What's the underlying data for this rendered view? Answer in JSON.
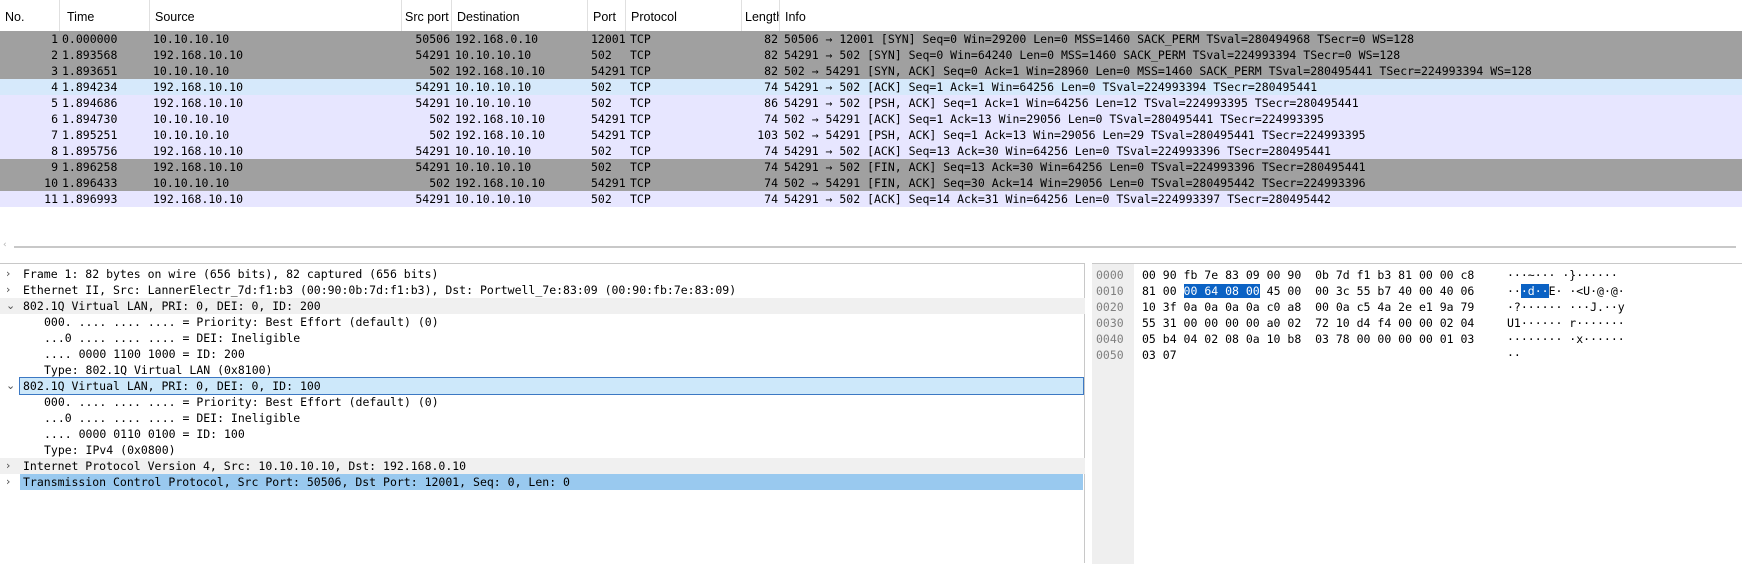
{
  "columns": [
    "No.",
    "Time",
    "Source",
    "Src port",
    "Destination",
    "Port",
    "Protocol",
    "Length",
    "Info"
  ],
  "packets": [
    {
      "no": "1",
      "time": "0.000000",
      "src": "10.10.10.10",
      "sport": "50506",
      "dst": "192.168.0.10",
      "port": "12001",
      "proto": "TCP",
      "len": "82",
      "info": "50506 → 12001 [SYN] Seq=0 Win=29200 Len=0 MSS=1460 SACK_PERM TSval=280494968 TSecr=0 WS=128",
      "style": "gray"
    },
    {
      "no": "2",
      "time": "1.893568",
      "src": "192.168.10.10",
      "sport": "54291",
      "dst": "10.10.10.10",
      "port": "502",
      "proto": "TCP",
      "len": "82",
      "info": "54291 → 502 [SYN] Seq=0 Win=64240 Len=0 MSS=1460 SACK_PERM TSval=224993394 TSecr=0 WS=128",
      "style": "gray"
    },
    {
      "no": "3",
      "time": "1.893651",
      "src": "10.10.10.10",
      "sport": "502",
      "dst": "192.168.10.10",
      "port": "54291",
      "proto": "TCP",
      "len": "82",
      "info": "502 → 54291 [SYN, ACK] Seq=0 Ack=1 Win=28960 Len=0 MSS=1460 SACK_PERM TSval=280495441 TSecr=224993394 WS=128",
      "style": "gray"
    },
    {
      "no": "4",
      "time": "1.894234",
      "src": "192.168.10.10",
      "sport": "54291",
      "dst": "10.10.10.10",
      "port": "502",
      "proto": "TCP",
      "len": "74",
      "info": "54291 → 502 [ACK] Seq=1 Ack=1 Win=64256 Len=0 TSval=224993394 TSecr=280495441",
      "style": "sel"
    },
    {
      "no": "5",
      "time": "1.894686",
      "src": "192.168.10.10",
      "sport": "54291",
      "dst": "10.10.10.10",
      "port": "502",
      "proto": "TCP",
      "len": "86",
      "info": "54291 → 502 [PSH, ACK] Seq=1 Ack=1 Win=64256 Len=12 TSval=224993395 TSecr=280495441",
      "style": "light"
    },
    {
      "no": "6",
      "time": "1.894730",
      "src": "10.10.10.10",
      "sport": "502",
      "dst": "192.168.10.10",
      "port": "54291",
      "proto": "TCP",
      "len": "74",
      "info": "502 → 54291 [ACK] Seq=1 Ack=13 Win=29056 Len=0 TSval=280495441 TSecr=224993395",
      "style": "light"
    },
    {
      "no": "7",
      "time": "1.895251",
      "src": "10.10.10.10",
      "sport": "502",
      "dst": "192.168.10.10",
      "port": "54291",
      "proto": "TCP",
      "len": "103",
      "info": "502 → 54291 [PSH, ACK] Seq=1 Ack=13 Win=29056 Len=29 TSval=280495441 TSecr=224993395",
      "style": "light"
    },
    {
      "no": "8",
      "time": "1.895756",
      "src": "192.168.10.10",
      "sport": "54291",
      "dst": "10.10.10.10",
      "port": "502",
      "proto": "TCP",
      "len": "74",
      "info": "54291 → 502 [ACK] Seq=13 Ack=30 Win=64256 Len=0 TSval=224993396 TSecr=280495441",
      "style": "light"
    },
    {
      "no": "9",
      "time": "1.896258",
      "src": "192.168.10.10",
      "sport": "54291",
      "dst": "10.10.10.10",
      "port": "502",
      "proto": "TCP",
      "len": "74",
      "info": "54291 → 502 [FIN, ACK] Seq=13 Ack=30 Win=64256 Len=0 TSval=224993396 TSecr=280495441",
      "style": "gray"
    },
    {
      "no": "10",
      "time": "1.896433",
      "src": "10.10.10.10",
      "sport": "502",
      "dst": "192.168.10.10",
      "port": "54291",
      "proto": "TCP",
      "len": "74",
      "info": "502 → 54291 [FIN, ACK] Seq=30 Ack=14 Win=29056 Len=0 TSval=280495442 TSecr=224993396",
      "style": "gray"
    },
    {
      "no": "11",
      "time": "1.896993",
      "src": "192.168.10.10",
      "sport": "54291",
      "dst": "10.10.10.10",
      "port": "502",
      "proto": "TCP",
      "len": "74",
      "info": "54291 → 502 [ACK] Seq=14 Ack=31 Win=64256 Len=0 TSval=224993397 TSecr=280495442",
      "style": "light"
    }
  ],
  "details": [
    {
      "text": "Frame 1: 82 bytes on wire (656 bits), 82 captured (656 bits)",
      "arrow": "right",
      "level": 0,
      "style": ""
    },
    {
      "text": "Ethernet II, Src: LannerElectr_7d:f1:b3 (00:90:0b:7d:f1:b3), Dst: Portwell_7e:83:09 (00:90:fb:7e:83:09)",
      "arrow": "right",
      "level": 0,
      "style": ""
    },
    {
      "text": "802.1Q Virtual LAN, PRI: 0, DEI: 0, ID: 200",
      "arrow": "down",
      "level": 0,
      "style": "bg"
    },
    {
      "text": "000. .... .... .... = Priority: Best Effort (default) (0)",
      "arrow": "",
      "level": 1,
      "style": ""
    },
    {
      "text": "...0 .... .... .... = DEI: Ineligible",
      "arrow": "",
      "level": 1,
      "style": ""
    },
    {
      "text": ".... 0000 1100 1000 = ID: 200",
      "arrow": "",
      "level": 1,
      "style": ""
    },
    {
      "text": "Type: 802.1Q Virtual LAN (0x8100)",
      "arrow": "",
      "level": 1,
      "style": ""
    },
    {
      "text": "802.1Q Virtual LAN, PRI: 0, DEI: 0, ID: 100",
      "arrow": "down",
      "level": 0,
      "style": "sel"
    },
    {
      "text": "000. .... .... .... = Priority: Best Effort (default) (0)",
      "arrow": "",
      "level": 1,
      "style": ""
    },
    {
      "text": "...0 .... .... .... = DEI: Ineligible",
      "arrow": "",
      "level": 1,
      "style": ""
    },
    {
      "text": ".... 0000 0110 0100 = ID: 100",
      "arrow": "",
      "level": 1,
      "style": ""
    },
    {
      "text": "Type: IPv4 (0x0800)",
      "arrow": "",
      "level": 1,
      "style": ""
    },
    {
      "text": "Internet Protocol Version 4, Src: 10.10.10.10, Dst: 192.168.0.10",
      "arrow": "right",
      "level": 0,
      "style": "bg"
    },
    {
      "text": "Transmission Control Protocol, Src Port: 50506, Dst Port: 12001, Seq: 0, Len: 0",
      "arrow": "right",
      "level": 0,
      "style": "selblue"
    }
  ],
  "bytes": [
    {
      "off": "0000",
      "pre": "00 90 fb 7e 83 09 00 90  0b 7d f1 b3 81 00 00 c8",
      "hl": "",
      "post": "",
      "apre": "···~··· ·}······",
      "ahl": "",
      "apost": ""
    },
    {
      "off": "0010",
      "pre": "81 00 ",
      "hl": "00 64 08 00",
      "post": " 45 00  00 3c 55 b7 40 00 40 06",
      "apre": "··",
      "ahl": "·d··",
      "apost": "E· ·<U·@·@·"
    },
    {
      "off": "0020",
      "pre": "10 3f 0a 0a 0a 0a c0 a8  00 0a c5 4a 2e e1 9a 79",
      "hl": "",
      "post": "",
      "apre": "·?······ ···J.··y",
      "ahl": "",
      "apost": ""
    },
    {
      "off": "0030",
      "pre": "55 31 00 00 00 00 a0 02  72 10 d4 f4 00 00 02 04",
      "hl": "",
      "post": "",
      "apre": "U1······ r·······",
      "ahl": "",
      "apost": ""
    },
    {
      "off": "0040",
      "pre": "05 b4 04 02 08 0a 10 b8  03 78 00 00 00 00 01 03",
      "hl": "",
      "post": "",
      "apre": "········ ·x······",
      "ahl": "",
      "apost": ""
    },
    {
      "off": "0050",
      "pre": "03 07",
      "hl": "",
      "post": "",
      "apre": "··",
      "ahl": "",
      "apost": ""
    }
  ],
  "colors": {
    "gray": "#a0a0a0",
    "light": "#e7e6ff",
    "selected": "#d6e9fb",
    "highlight": "#0b62c4"
  }
}
